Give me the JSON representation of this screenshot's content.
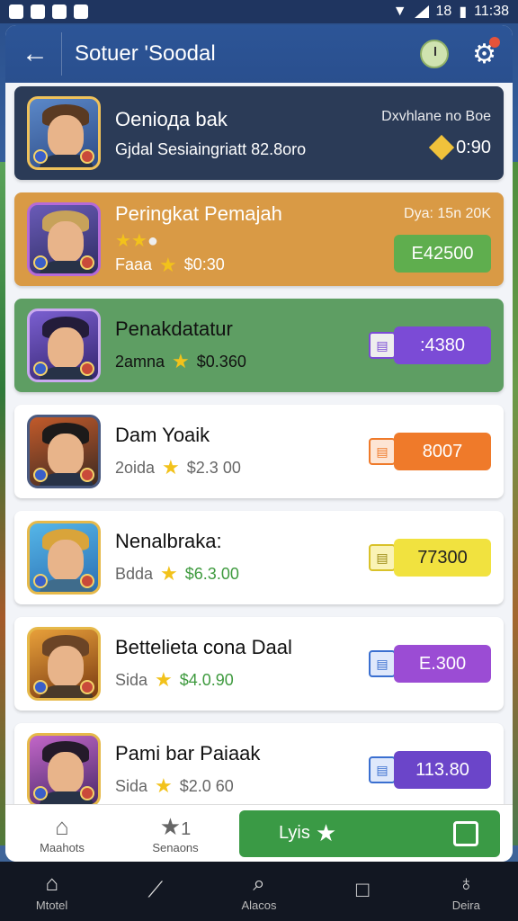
{
  "status": {
    "time": "11:38",
    "battery_label": "18"
  },
  "header": {
    "title": "Sotuer 'Soodal"
  },
  "cards": [
    {
      "title": "Oeniода bak",
      "subtitle": "Gjdal  Sesiaingriatt  82.8oro",
      "note": "Dxvhlane no Boe",
      "price": "0:90",
      "theme": "dark"
    },
    {
      "title": "Peringkat Pemajah",
      "subtitle_label": "Faaa",
      "subtitle_price": "$0:30",
      "note": "Dya: 15n 20K",
      "price": "E42500",
      "theme": "orange",
      "button_color": "#5fae4e"
    },
    {
      "title": "Penakdatatur",
      "subtitle_label": "2amna",
      "subtitle_price": "$0.360",
      "price": ":4380",
      "theme": "green",
      "button_color": "#7b4bd6"
    },
    {
      "title": "Dam Yoaik",
      "subtitle_label": "2oida",
      "subtitle_price": "$2.3 00",
      "price": "8007",
      "theme": "white",
      "button_color": "#ef7a2a"
    },
    {
      "title": "Nenalbraka:",
      "subtitle_label": "Bdda",
      "subtitle_price": "$6.3.00",
      "price": "77300",
      "theme": "white",
      "button_color": "#f1e23f",
      "price_text_color": "#222"
    },
    {
      "title": "Bettelieta cona Daal",
      "subtitle_label": "Sida",
      "subtitle_price": "$4.0.90",
      "price": "E.300",
      "theme": "white",
      "button_color": "#9b4cd4"
    },
    {
      "title": "Pami bar Paiaak",
      "subtitle_label": "Sida",
      "subtitle_price": "$2.0 60",
      "price": "113.80",
      "theme": "white",
      "button_color": "#6b45c9"
    }
  ],
  "bottom_tabs": [
    {
      "label": "Maahots",
      "icon": "home-icon"
    },
    {
      "label": "Senaons",
      "icon": "star-icon",
      "count": "1"
    }
  ],
  "cta": {
    "label": "Lyis"
  },
  "nav": [
    {
      "label": "Mtotel",
      "icon": "home-icon"
    },
    {
      "label": "",
      "icon": "chart-icon"
    },
    {
      "label": "Alacos",
      "icon": "search-icon"
    },
    {
      "label": "",
      "icon": "square-icon"
    },
    {
      "label": "Deira",
      "icon": "person-icon"
    }
  ]
}
